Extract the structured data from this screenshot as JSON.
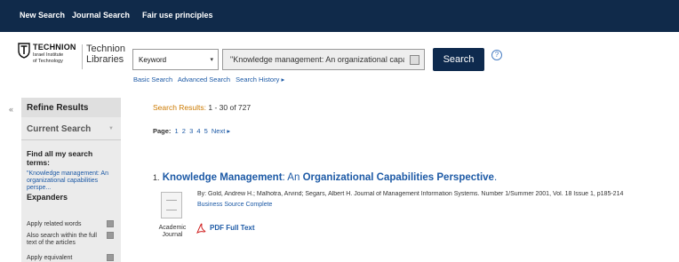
{
  "topnav": {
    "new_search": "New Search",
    "journal_search": "Journal Search",
    "fair_use": "Fair use principles"
  },
  "logo": {
    "name": "TECHNION",
    "subtitle_line1": "Israel Institute",
    "subtitle_line2": "of Technology",
    "libraries_line1": "Technion",
    "libraries_line2": "Libraries"
  },
  "search": {
    "field_select": "Keyword",
    "query": "\"Knowledge management: An organizational capabilities perspective\"",
    "button": "Search",
    "help": "?"
  },
  "search_links": {
    "basic": "Basic Search",
    "advanced": "Advanced Search",
    "history": "Search History ▸"
  },
  "sidebar": {
    "collapse_glyph": "«",
    "refine_title": "Refine Results",
    "current_search": "Current Search",
    "find_all_label": "Find all my search terms:",
    "current_term": "\"Knowledge management: An organizational capabilities perspe...",
    "expanders_title": "Expanders",
    "options": [
      "Apply related words",
      "Also search within the full text of the articles",
      "Apply equivalent"
    ]
  },
  "results": {
    "count_label": "Search Results:",
    "count_value": "1 - 30 of 727",
    "page_label": "Page:",
    "pages": [
      "1",
      "2",
      "3",
      "4",
      "5"
    ],
    "next": "Next ▸"
  },
  "result1": {
    "number": "1.",
    "title_parts": [
      "Knowledge Management",
      ": An ",
      "Organizational Capabilities Perspective",
      "."
    ],
    "meta": "By: Gold, Andrew H.; Malhotra, Arvind; Segars, Albert H. Journal of Management Information Systems. Number 1/Summer 2001, Vol. 18 Issue 1, p185-214",
    "database": "Business Source Complete",
    "doc_type_line1": "Academic",
    "doc_type_line2": "Journal",
    "pdf_link": "PDF Full Text"
  }
}
